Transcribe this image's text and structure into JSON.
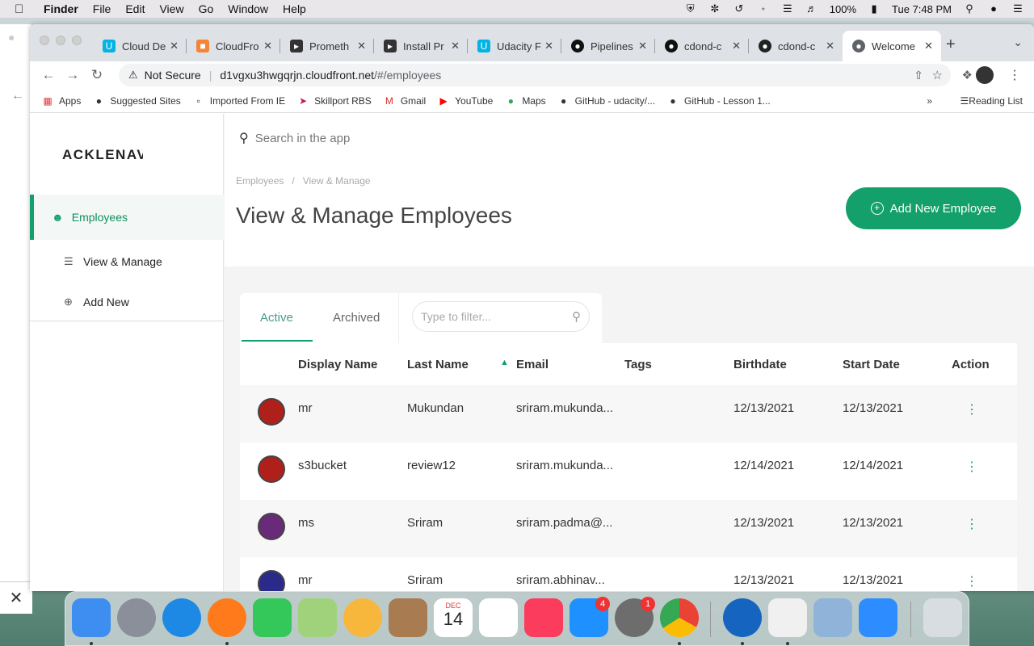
{
  "menubar": {
    "app": "Finder",
    "items": [
      "File",
      "Edit",
      "View",
      "Go",
      "Window",
      "Help"
    ],
    "battery": "100%",
    "clock": "Tue 7:48 PM"
  },
  "tabs": [
    {
      "label": "Cloud De",
      "color": "#02b3e4"
    },
    {
      "label": "CloudFro",
      "color": "#f58536"
    },
    {
      "label": "Prometh",
      "color": "#333333"
    },
    {
      "label": "Install Pr",
      "color": "#333333"
    },
    {
      "label": "Udacity F",
      "color": "#02b3e4"
    },
    {
      "label": "Pipelines",
      "color": "#111111"
    },
    {
      "label": "cdond-c",
      "color": "#111111"
    },
    {
      "label": "cdond-c",
      "color": "#222222"
    },
    {
      "label": "Welcome",
      "color": "#5f6368"
    }
  ],
  "omnibox": {
    "security": "Not Secure",
    "url_host": "d1vgxu3hwgqrjn.cloudfront.net",
    "url_path": "/#/employees"
  },
  "bookmarks": [
    "Apps",
    "Suggested Sites",
    "Imported From IE",
    "Skillport RBS",
    "Gmail",
    "YouTube",
    "Maps",
    "GitHub - udacity/...",
    "GitHub - Lesson 1..."
  ],
  "reading_list": "Reading List",
  "app": {
    "logo": "ACKLENAVENUE",
    "nav": {
      "employees": "Employees",
      "view_manage": "View & Manage",
      "add_new": "Add New"
    },
    "search_placeholder": "Search in the app",
    "breadcrumb": [
      "Employees",
      "View & Manage"
    ],
    "page_title": "View & Manage Employees",
    "add_button": "Add New Employee",
    "tabs": {
      "active": "Active",
      "archived": "Archived"
    },
    "filter_placeholder": "Type to filter...",
    "columns": [
      "Display Name",
      "Last Name",
      "Email",
      "Tags",
      "Birthdate",
      "Start Date",
      "Action"
    ],
    "rows": [
      {
        "display": "mr",
        "last": "Mukundan",
        "email": "sriram.mukunda...",
        "tags": "",
        "birth": "12/13/2021",
        "start": "12/13/2021",
        "avatar": "#b0201b"
      },
      {
        "display": "s3bucket",
        "last": "review12",
        "email": "sriram.mukunda...",
        "tags": "",
        "birth": "12/14/2021",
        "start": "12/14/2021",
        "avatar": "#b0201b"
      },
      {
        "display": "ms",
        "last": "Sriram",
        "email": "sriram.padma@...",
        "tags": "",
        "birth": "12/13/2021",
        "start": "12/13/2021",
        "avatar": "#6a2a7a"
      },
      {
        "display": "mr",
        "last": "Sriram",
        "email": "sriram.abhinav...",
        "tags": "",
        "birth": "12/13/2021",
        "start": "12/13/2021",
        "avatar": "#2a2a8a"
      }
    ]
  },
  "dock": {
    "calendar_month": "DEC",
    "calendar_day": "14",
    "appstore_badge": "4",
    "prefs_badge": "1",
    "apps": [
      {
        "name": "finder",
        "color": "#3d8ef0"
      },
      {
        "name": "launchpad",
        "color": "#8a8f99"
      },
      {
        "name": "safari",
        "color": "#1e88e5"
      },
      {
        "name": "firefox",
        "color": "#ff7a1a"
      },
      {
        "name": "facetime",
        "color": "#34c759"
      },
      {
        "name": "maps",
        "color": "#9fd27b"
      },
      {
        "name": "photos",
        "color": "#f6b73c"
      },
      {
        "name": "contacts",
        "color": "#a97b50"
      },
      {
        "name": "calendar",
        "color": "#ffffff"
      },
      {
        "name": "reminders",
        "color": "#ffffff"
      },
      {
        "name": "music",
        "color": "#fc3c5c"
      },
      {
        "name": "app-store",
        "color": "#1e90ff"
      },
      {
        "name": "system-preferences",
        "color": "#6d6d6d"
      },
      {
        "name": "chrome",
        "color": "#ffffff"
      },
      {
        "name": "dialpad",
        "color": "#1565c0"
      },
      {
        "name": "textedit",
        "color": "#f0f0f0"
      },
      {
        "name": "preview",
        "color": "#8fb3d9"
      },
      {
        "name": "zoom",
        "color": "#2d8cff"
      },
      {
        "name": "trash",
        "color": "#d8dde2"
      }
    ]
  }
}
